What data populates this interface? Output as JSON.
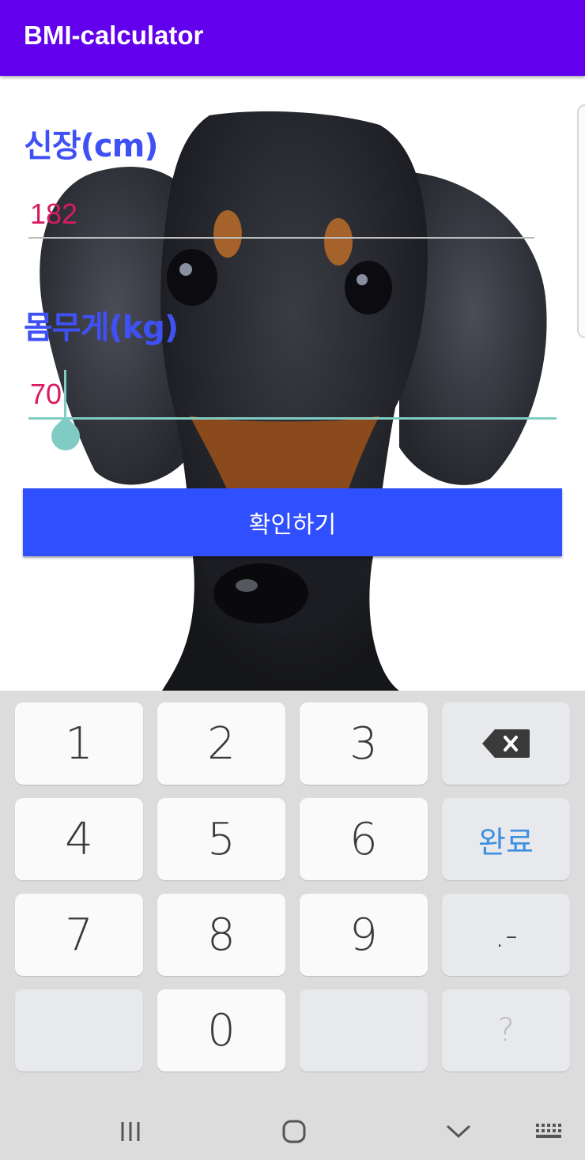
{
  "app": {
    "title": "BMI-calculator"
  },
  "form": {
    "height_label": "신장(cm)",
    "height_value": "182",
    "weight_label": "몸무게(kg)",
    "weight_value": "70",
    "confirm_label": "확인하기"
  },
  "keyboard": {
    "keys": [
      {
        "label": "1",
        "type": "digit"
      },
      {
        "label": "2",
        "type": "digit"
      },
      {
        "label": "3",
        "type": "digit"
      },
      {
        "label": "",
        "type": "backspace",
        "icon": "backspace-icon"
      },
      {
        "label": "4",
        "type": "digit"
      },
      {
        "label": "5",
        "type": "digit"
      },
      {
        "label": "6",
        "type": "digit"
      },
      {
        "label": "완료",
        "type": "done"
      },
      {
        "label": "7",
        "type": "digit"
      },
      {
        "label": "8",
        "type": "digit"
      },
      {
        "label": "9",
        "type": "digit"
      },
      {
        "label": ".-",
        "type": "symbol"
      },
      {
        "label": "",
        "type": "empty"
      },
      {
        "label": "0",
        "type": "digit"
      },
      {
        "label": "",
        "type": "empty"
      },
      {
        "label": "?",
        "type": "muted"
      }
    ]
  },
  "navigation": {
    "buttons": [
      "recent-apps-icon",
      "home-icon",
      "back-icon",
      "keyboard-switch-icon"
    ]
  },
  "colors": {
    "app_bar": "#6200EE",
    "label": "#3F51F5",
    "input_text": "#D81B60",
    "accent": "#80CBC4",
    "button": "#304FFE",
    "done_key": "#3D8FE0"
  }
}
